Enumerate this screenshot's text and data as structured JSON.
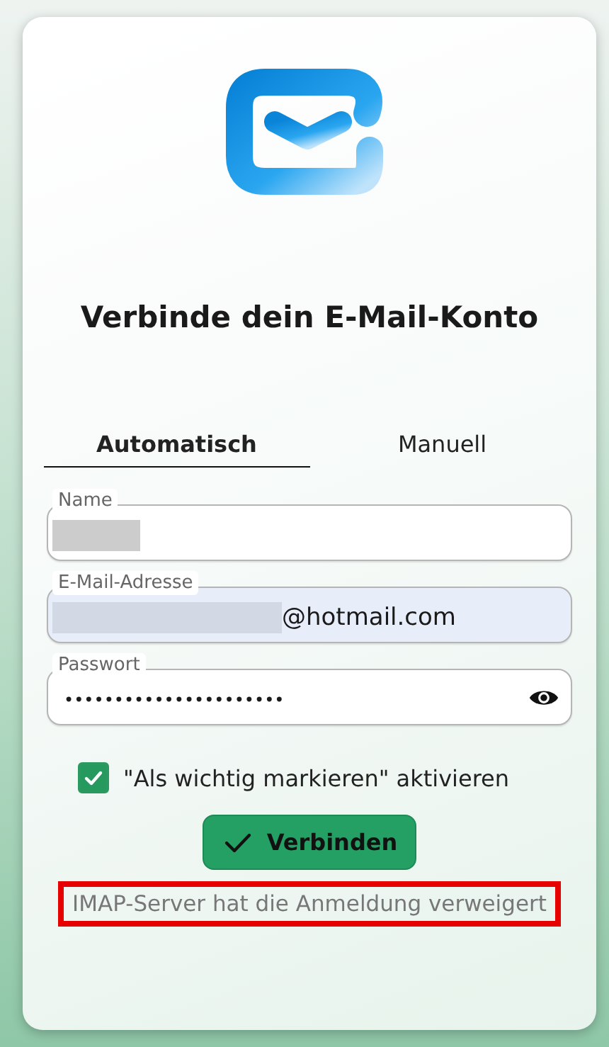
{
  "title": "Verbinde dein E-Mail-Konto",
  "tabs": [
    {
      "label": "Automatisch",
      "selected": true
    },
    {
      "label": "Manuell",
      "selected": false
    }
  ],
  "fields": [
    {
      "kind": "text",
      "label": "Name",
      "redacted": true,
      "focused": false
    },
    {
      "kind": "text",
      "label": "E-Mail-Adresse",
      "value": "@hotmail.com",
      "redacted": true,
      "focused": true
    },
    {
      "kind": "password",
      "label": "Passwort",
      "value": "••••••••••••••••••••••",
      "focused": false
    }
  ],
  "checkbox": {
    "label": "\"Als wichtig markieren\" aktivieren",
    "checked": true
  },
  "button": {
    "label": "Verbinden"
  },
  "error": {
    "text": "IMAP-Server hat die Anmeldung verweigert",
    "highlighted": true
  }
}
